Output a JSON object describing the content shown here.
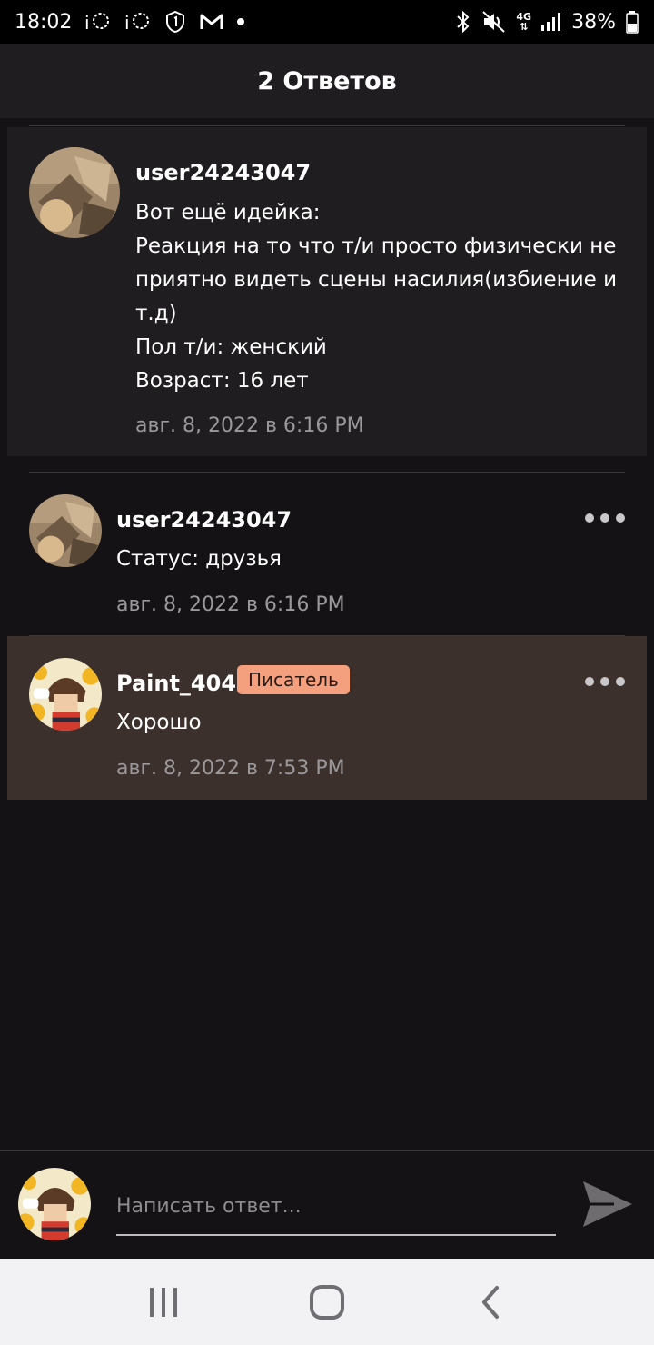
{
  "status_bar": {
    "time": "18:02",
    "network": "4G",
    "battery": "38%"
  },
  "header": {
    "title": "2 Ответов"
  },
  "comments": [
    {
      "author": "user24243047",
      "lines": [
        "Вот ещё идейка:",
        "Реакция на то что т/и просто физически не",
        "приятно видеть сцены насилия(избиение и",
        "т.д)",
        "Пол т/и: женский",
        "Возраст: 16 лет"
      ],
      "timestamp": "авг. 8, 2022 в 6:16 PM"
    },
    {
      "author": "user24243047",
      "text": "Статус: друзья",
      "timestamp": "авг. 8, 2022 в 6:16 PM"
    },
    {
      "author": "Paint_404",
      "badge": "Писатель",
      "text": "Хорошо",
      "timestamp": "авг. 8, 2022 в 7:53 PM"
    }
  ],
  "reply": {
    "placeholder": "Написать ответ..."
  },
  "colors": {
    "background": "#141214",
    "header": "#1f1d1f",
    "highlight": "#3c302d",
    "badge": "#f4a07f"
  }
}
